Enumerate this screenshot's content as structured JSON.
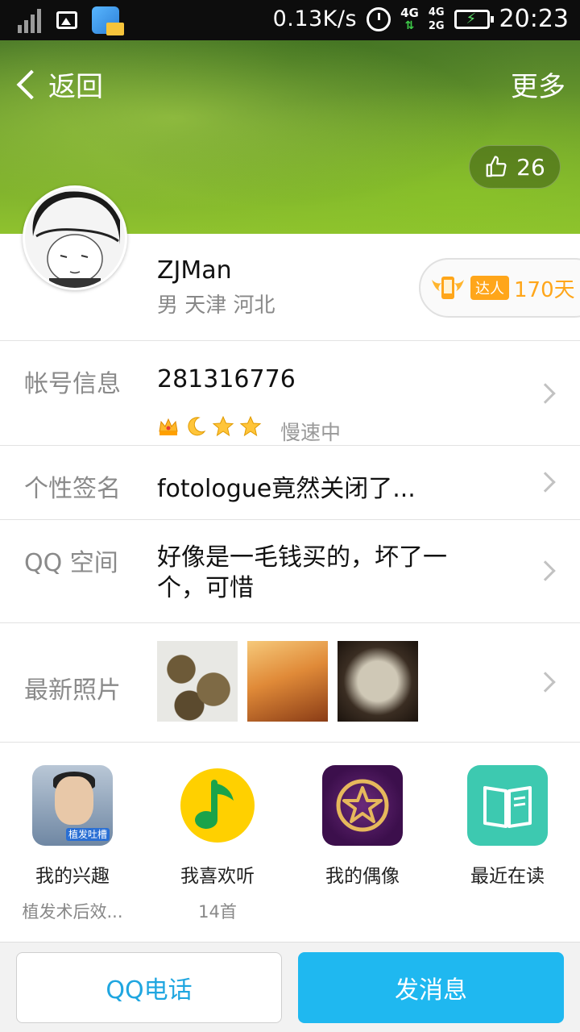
{
  "status_bar": {
    "net_speed": "0.13K/s",
    "net_4g": "4G",
    "sim1": "4G",
    "sim2": "2G",
    "time": "20:23"
  },
  "header": {
    "back_label": "返回",
    "more_label": "更多",
    "like_count": "26"
  },
  "profile": {
    "nickname": "ZJMan",
    "meta": "男 天津 河北",
    "daren_tag": "达人",
    "daren_days": "170天"
  },
  "rows": {
    "account": {
      "label": "帐号信息",
      "qq_number": "281316776",
      "status": "慢速中"
    },
    "signature": {
      "label": "个性签名",
      "value": "fotologue竟然关闭了..."
    },
    "qzone": {
      "label": "QQ 空间",
      "value": "好像是一毛钱买的，坏了一个，可惜"
    },
    "photos": {
      "label": "最新照片"
    }
  },
  "grid": [
    {
      "title": "我的兴趣",
      "sub": "植发术后效..."
    },
    {
      "title": "我喜欢听",
      "sub": "14首"
    },
    {
      "title": "我的偶像",
      "sub": ""
    },
    {
      "title": "最近在读",
      "sub": ""
    }
  ],
  "interest_tag": "植发吐槽",
  "bottom": {
    "call_label": "QQ电话",
    "message_label": "发消息"
  },
  "colors": {
    "accent": "#1fb8f0",
    "daren": "#ffa61a",
    "banner": "#6e9f2c"
  }
}
